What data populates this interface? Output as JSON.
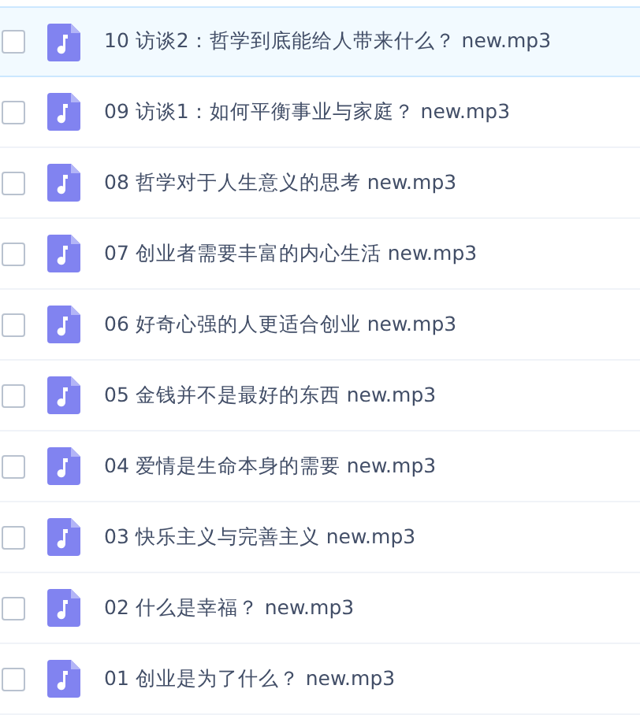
{
  "files": [
    {
      "name": "10 访谈2：哲学到底能给人带来什么？ new.mp3",
      "selected": true,
      "checked": false
    },
    {
      "name": "09 访谈1：如何平衡事业与家庭？ new.mp3",
      "selected": false,
      "checked": false
    },
    {
      "name": "08 哲学对于人生意义的思考 new.mp3",
      "selected": false,
      "checked": false
    },
    {
      "name": "07 创业者需要丰富的内心生活 new.mp3",
      "selected": false,
      "checked": false
    },
    {
      "name": "06 好奇心强的人更适合创业 new.mp3",
      "selected": false,
      "checked": false
    },
    {
      "name": "05 金钱并不是最好的东西 new.mp3",
      "selected": false,
      "checked": false
    },
    {
      "name": "04 爱情是生命本身的需要 new.mp3",
      "selected": false,
      "checked": false
    },
    {
      "name": "03 快乐主义与完善主义 new.mp3",
      "selected": false,
      "checked": false
    },
    {
      "name": "02 什么是幸福？ new.mp3",
      "selected": false,
      "checked": false
    },
    {
      "name": "01 创业是为了什么？ new.mp3",
      "selected": false,
      "checked": false
    }
  ]
}
